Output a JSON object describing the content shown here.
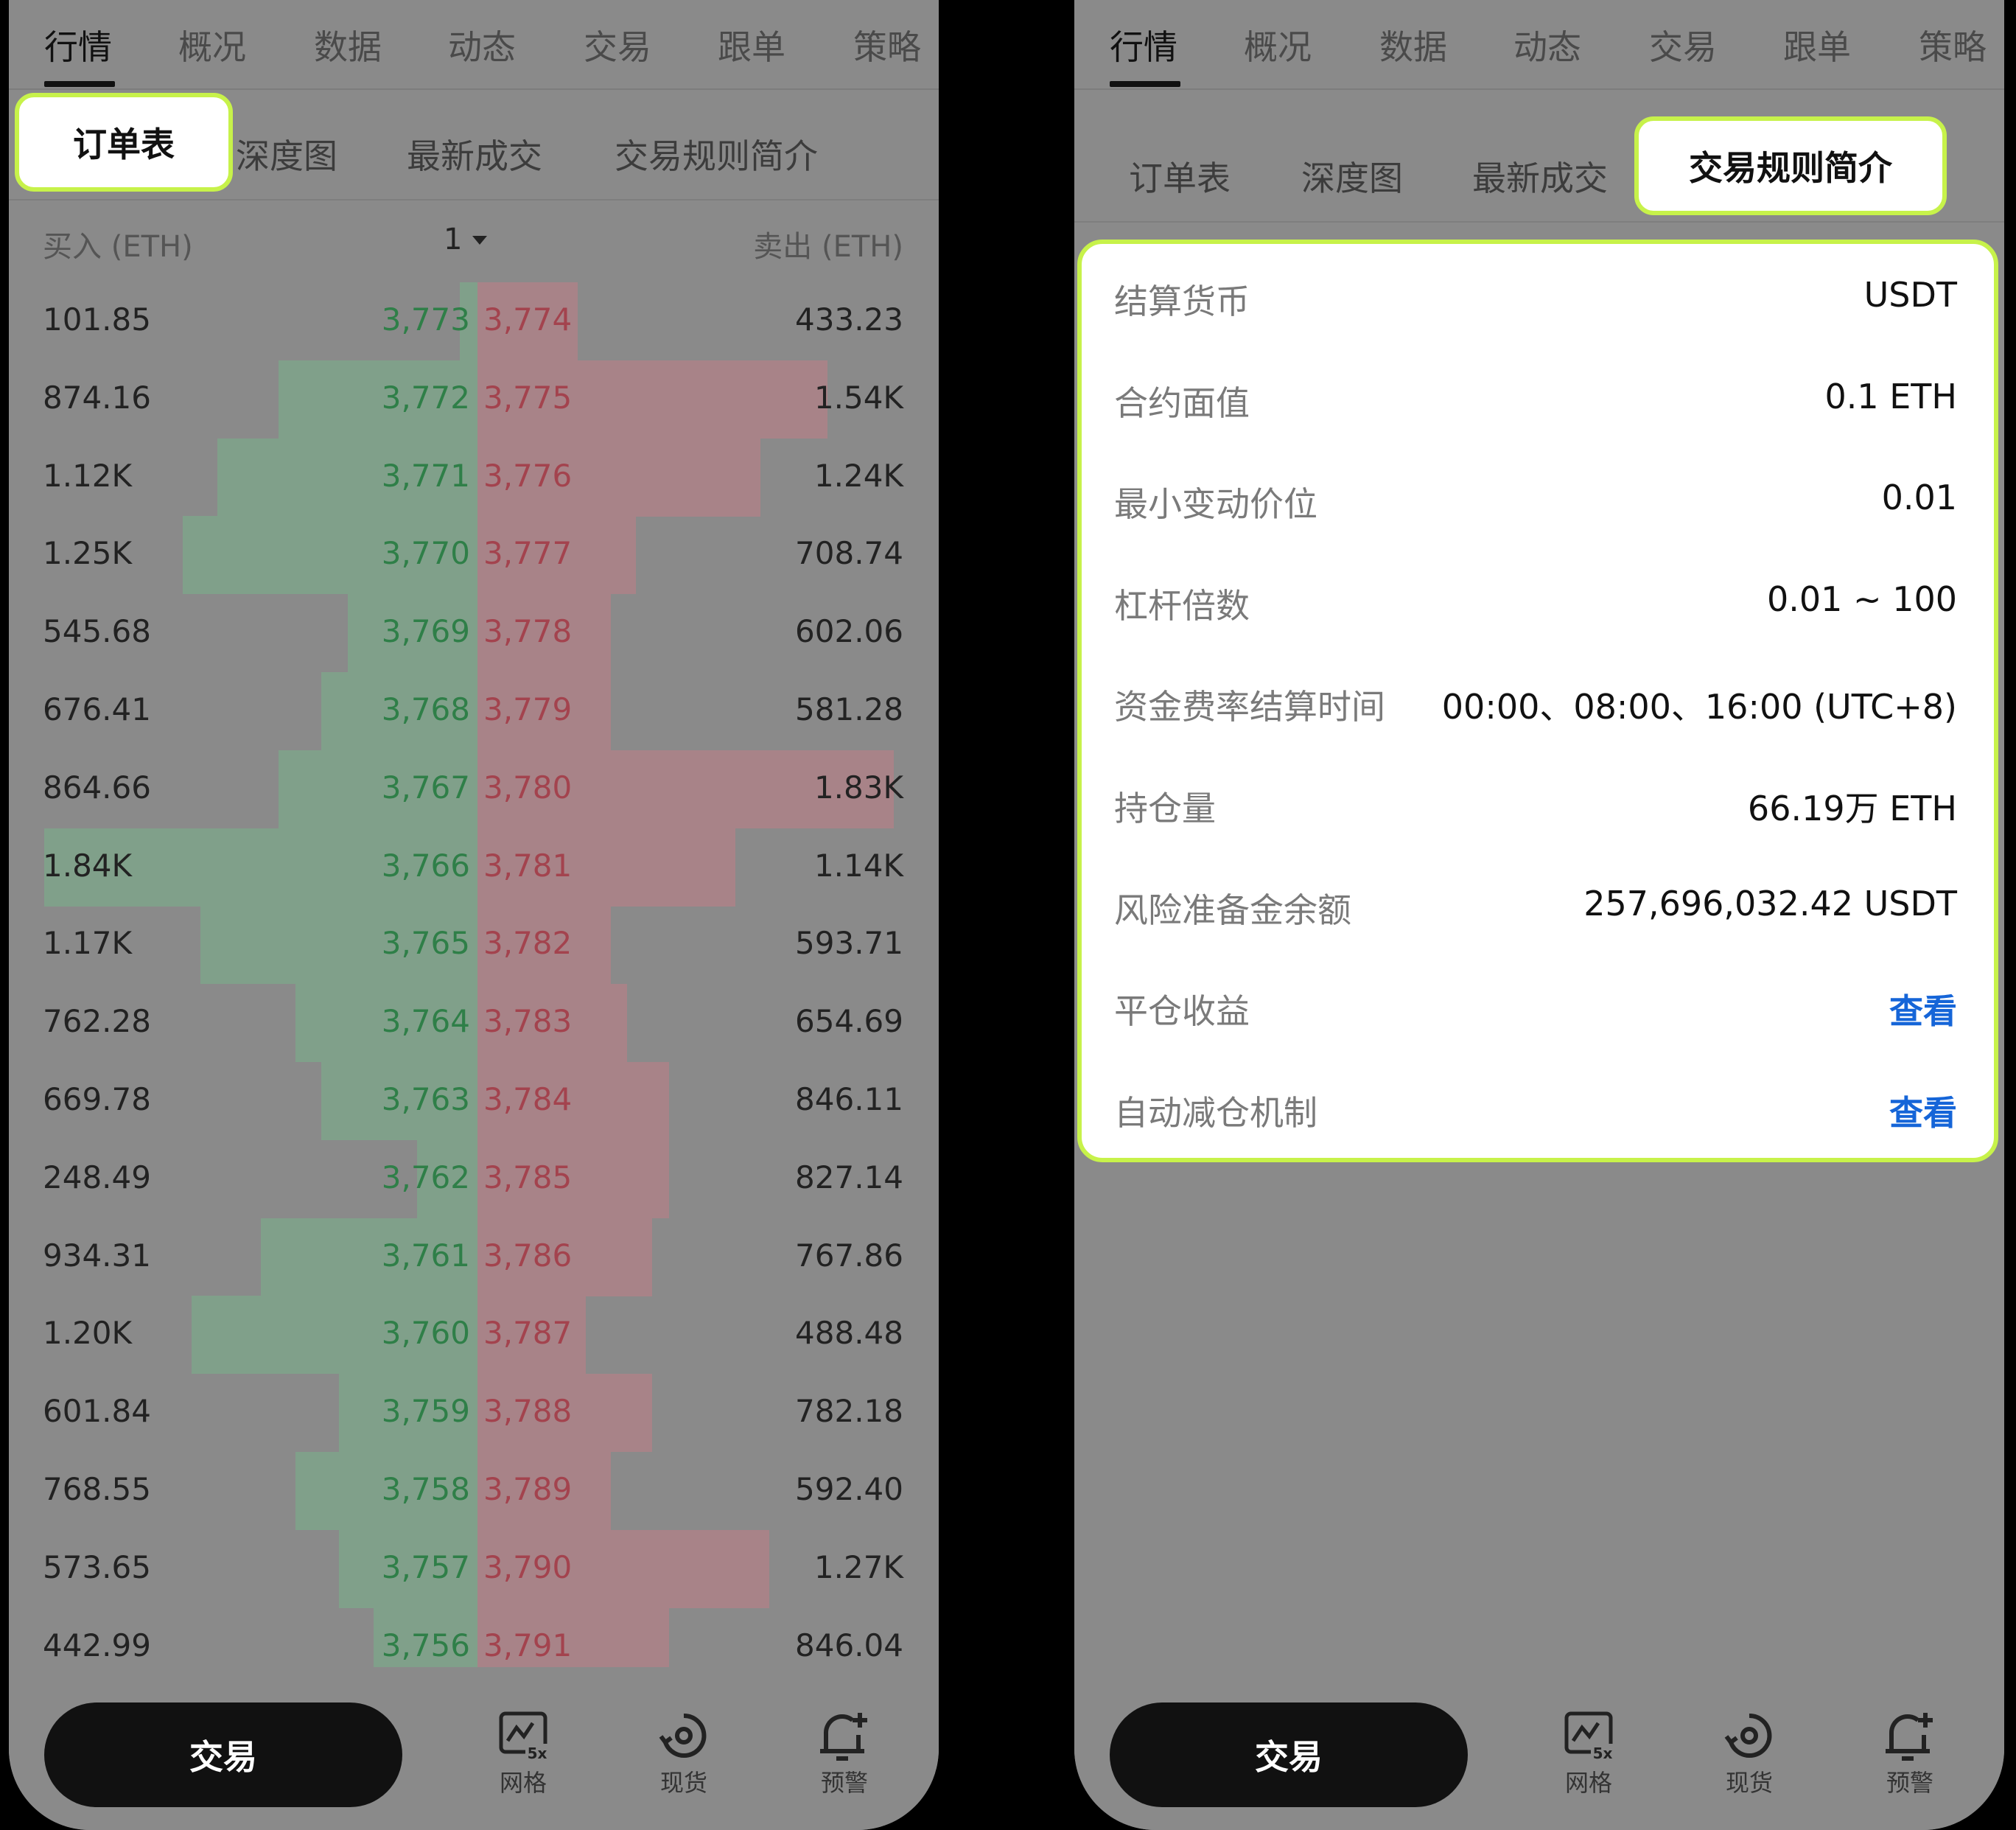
{
  "top_tabs": [
    "行情",
    "概况",
    "数据",
    "动态",
    "交易",
    "跟单",
    "策略"
  ],
  "sub_tabs": [
    "订单表",
    "深度图",
    "最新成交",
    "交易规则简介"
  ],
  "orderbook": {
    "buy_header": "买入 (ETH)",
    "sell_header": "卖出 (ETH)",
    "precision": "1",
    "rows": [
      {
        "bid_qty": "101.85",
        "bid_price": "3,773",
        "ask_price": "3,774",
        "ask_qty": "433.23",
        "bid_depth": 0.02,
        "ask_depth": 0.12
      },
      {
        "bid_qty": "874.16",
        "bid_price": "3,772",
        "ask_price": "3,775",
        "ask_qty": "1.54K",
        "bid_depth": 0.23,
        "ask_depth": 0.42
      },
      {
        "bid_qty": "1.12K",
        "bid_price": "3,771",
        "ask_price": "3,776",
        "ask_qty": "1.24K",
        "bid_depth": 0.3,
        "ask_depth": 0.34
      },
      {
        "bid_qty": "1.25K",
        "bid_price": "3,770",
        "ask_price": "3,777",
        "ask_qty": "708.74",
        "bid_depth": 0.34,
        "ask_depth": 0.19
      },
      {
        "bid_qty": "545.68",
        "bid_price": "3,769",
        "ask_price": "3,778",
        "ask_qty": "602.06",
        "bid_depth": 0.15,
        "ask_depth": 0.16
      },
      {
        "bid_qty": "676.41",
        "bid_price": "3,768",
        "ask_price": "3,779",
        "ask_qty": "581.28",
        "bid_depth": 0.18,
        "ask_depth": 0.16
      },
      {
        "bid_qty": "864.66",
        "bid_price": "3,767",
        "ask_price": "3,780",
        "ask_qty": "1.83K",
        "bid_depth": 0.23,
        "ask_depth": 0.5
      },
      {
        "bid_qty": "1.84K",
        "bid_price": "3,766",
        "ask_price": "3,781",
        "ask_qty": "1.14K",
        "bid_depth": 0.5,
        "ask_depth": 0.31
      },
      {
        "bid_qty": "1.17K",
        "bid_price": "3,765",
        "ask_price": "3,782",
        "ask_qty": "593.71",
        "bid_depth": 0.32,
        "ask_depth": 0.16
      },
      {
        "bid_qty": "762.28",
        "bid_price": "3,764",
        "ask_price": "3,783",
        "ask_qty": "654.69",
        "bid_depth": 0.21,
        "ask_depth": 0.18
      },
      {
        "bid_qty": "669.78",
        "bid_price": "3,763",
        "ask_price": "3,784",
        "ask_qty": "846.11",
        "bid_depth": 0.18,
        "ask_depth": 0.23
      },
      {
        "bid_qty": "248.49",
        "bid_price": "3,762",
        "ask_price": "3,785",
        "ask_qty": "827.14",
        "bid_depth": 0.07,
        "ask_depth": 0.23
      },
      {
        "bid_qty": "934.31",
        "bid_price": "3,761",
        "ask_price": "3,786",
        "ask_qty": "767.86",
        "bid_depth": 0.25,
        "ask_depth": 0.21
      },
      {
        "bid_qty": "1.20K",
        "bid_price": "3,760",
        "ask_price": "3,787",
        "ask_qty": "488.48",
        "bid_depth": 0.33,
        "ask_depth": 0.13
      },
      {
        "bid_qty": "601.84",
        "bid_price": "3,759",
        "ask_price": "3,788",
        "ask_qty": "782.18",
        "bid_depth": 0.16,
        "ask_depth": 0.21
      },
      {
        "bid_qty": "768.55",
        "bid_price": "3,758",
        "ask_price": "3,789",
        "ask_qty": "592.40",
        "bid_depth": 0.21,
        "ask_depth": 0.16
      },
      {
        "bid_qty": "573.65",
        "bid_price": "3,757",
        "ask_price": "3,790",
        "ask_qty": "1.27K",
        "bid_depth": 0.16,
        "ask_depth": 0.35
      },
      {
        "bid_qty": "442.99",
        "bid_price": "3,756",
        "ask_price": "3,791",
        "ask_qty": "846.04",
        "bid_depth": 0.12,
        "ask_depth": 0.23
      }
    ]
  },
  "rules": [
    {
      "label": "结算货币",
      "value": "USDT",
      "link": false
    },
    {
      "label": "合约面值",
      "value": "0.1 ETH",
      "link": false
    },
    {
      "label": "最小变动价位",
      "value": "0.01",
      "link": false
    },
    {
      "label": "杠杆倍数",
      "value": "0.01 ~ 100",
      "link": false
    },
    {
      "label": "资金费率结算时间",
      "value": "00:00、08:00、16:00 (UTC+8)",
      "link": false
    },
    {
      "label": "持仓量",
      "value": "66.19万 ETH",
      "link": false
    },
    {
      "label": "风险准备金余额",
      "value": "257,696,032.42 USDT",
      "link": false
    },
    {
      "label": "平仓收益",
      "value": "查看",
      "link": true
    },
    {
      "label": "自动减仓机制",
      "value": "查看",
      "link": true
    }
  ],
  "bottom_bar": {
    "trade_label": "交易",
    "icons": [
      {
        "name": "grid-icon",
        "label": "网格",
        "badge": "5x"
      },
      {
        "name": "spot-icon",
        "label": "现货"
      },
      {
        "name": "alert-icon",
        "label": "预警"
      }
    ]
  },
  "colors": {
    "accent_outline": "#c7f24a",
    "bid": "#2f7f48",
    "ask": "#a3434e",
    "link": "#1565d8"
  }
}
